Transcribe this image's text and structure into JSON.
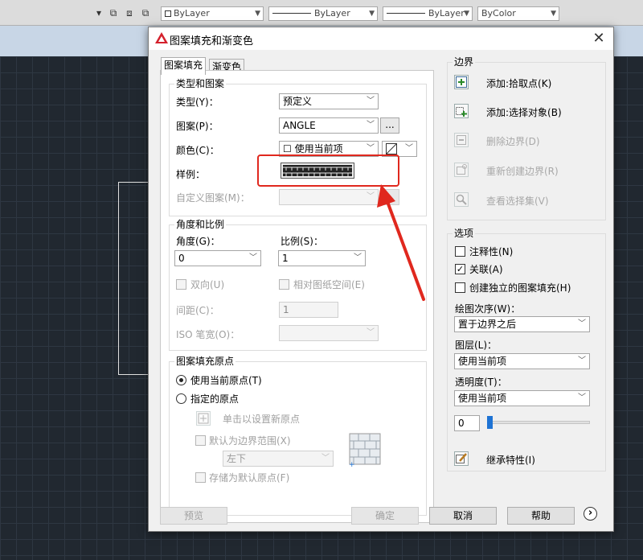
{
  "toolbar": {
    "layer_combo": "ByLayer",
    "linetype_combo": "ByLayer",
    "lineweight_combo": "ByLayer",
    "color_combo": "ByColor"
  },
  "dialog": {
    "title": "图案填充和渐变色",
    "close_glyph": "✕",
    "tabs": [
      "图案填充",
      "渐变色"
    ],
    "type_group": {
      "title": "类型和图案",
      "type_label": "类型(Y)：",
      "type_value": "预定义",
      "pattern_label": "图案(P)：",
      "pattern_value": "ANGLE",
      "ellipsis": "...",
      "color_label": "颜色(C)：",
      "color_value": "☐ 使用当前项",
      "sample_label": "样例：",
      "custom_label": "自定义图案(M)："
    },
    "angle_group": {
      "title": "角度和比例",
      "angle_label": "角度(G)：",
      "angle_value": "0",
      "scale_label": "比例(S)：",
      "scale_value": "1",
      "double_label": "双向(U)",
      "relative_label": "相对图纸空间(E)",
      "spacing_label": "间距(C)：",
      "spacing_value": "1",
      "iso_label": "ISO 笔宽(O)："
    },
    "origin_group": {
      "title": "图案填充原点",
      "use_current_label": "使用当前原点(T)",
      "specified_label": "指定的原点",
      "click_set_label": "单击以设置新原点",
      "default_boundary_label": "默认为边界范围(X)",
      "position_value": "左下",
      "store_default_label": "存储为默认原点(F)"
    },
    "boundary": {
      "title": "边界",
      "add_pick_label": "添加:拾取点(K)",
      "add_select_label": "添加:选择对象(B)",
      "remove_label": "删除边界(D)",
      "recreate_label": "重新创建边界(R)",
      "view_label": "查看选择集(V)"
    },
    "options": {
      "title": "选项",
      "annotative_label": "注释性(N)",
      "associative_label": "关联(A)",
      "associative_checked": "✓",
      "separate_label": "创建独立的图案填充(H)",
      "draw_order_label": "绘图次序(W)：",
      "draw_order_value": "置于边界之后",
      "layer_label": "图层(L)：",
      "layer_value": "使用当前项",
      "transparency_label": "透明度(T)：",
      "transparency_value": "使用当前项",
      "transparency_number": "0",
      "transparency_level": 0
    },
    "inherit_label": "继承特性(I)",
    "footer": {
      "preview": "预览",
      "ok": "确定",
      "cancel": "取消",
      "help": "帮助",
      "more": "›"
    }
  },
  "colors": {
    "highlight": "#e0281e",
    "arrow": "#e0281e",
    "background": "#212830",
    "accent": "#1e73d4"
  }
}
